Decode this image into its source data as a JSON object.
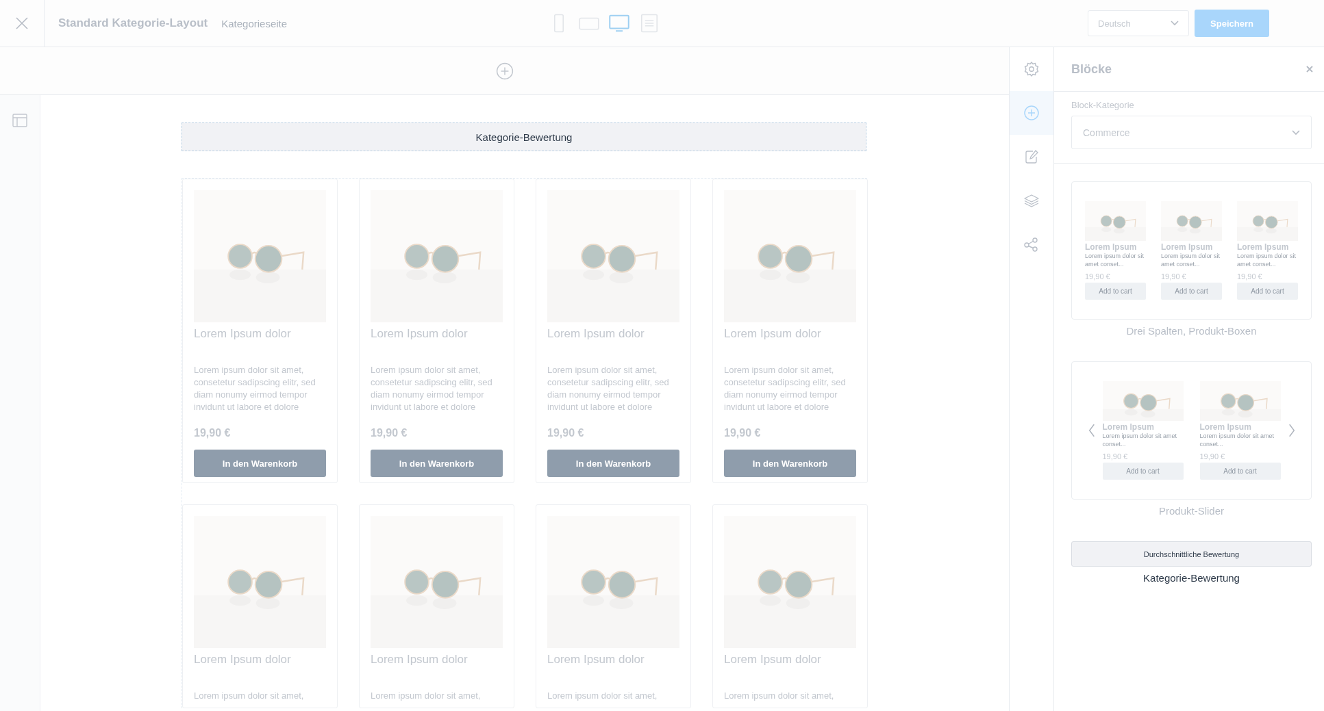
{
  "toolbar": {
    "title": "Standard Kategorie-Layout",
    "subtitle": "Kategorieseite",
    "devices": [
      {
        "kind": "mobile",
        "selected": false
      },
      {
        "kind": "tablet",
        "selected": false
      },
      {
        "kind": "desktop",
        "selected": true
      },
      {
        "kind": "list",
        "selected": false
      }
    ],
    "language": "Deutsch",
    "save": "Speichern"
  },
  "canvas": {
    "rating_block": "Kategorie-Bewertung",
    "products": [
      {
        "title": "Lorem Ipsum dolor",
        "description": "Lorem ipsum dolor sit amet, consetetur sadipscing elitr, sed diam nonumy eirmod tempor invidunt ut labore et dolore",
        "price": "19,90 €",
        "button": "In den Warenkorb"
      },
      {
        "title": "Lorem Ipsum dolor",
        "description": "Lorem ipsum dolor sit amet, consetetur sadipscing elitr, sed diam nonumy eirmod tempor invidunt ut labore et dolore",
        "price": "19,90 €",
        "button": "In den Warenkorb"
      },
      {
        "title": "Lorem Ipsum dolor",
        "description": "Lorem ipsum dolor sit amet, consetetur sadipscing elitr, sed diam nonumy eirmod tempor invidunt ut labore et dolore",
        "price": "19,90 €",
        "button": "In den Warenkorb"
      },
      {
        "title": "Lorem Ipsum dolor",
        "description": "Lorem ipsum dolor sit amet, consetetur sadipscing elitr, sed diam nonumy eirmod tempor invidunt ut labore et dolore",
        "price": "19,90 €",
        "button": "In den Warenkorb"
      },
      {
        "title": "Lorem Ipsum dolor",
        "description": "Lorem ipsum dolor sit amet,"
      },
      {
        "title": "Lorem Ipsum dolor",
        "description": "Lorem ipsum dolor sit amet,"
      },
      {
        "title": "Lorem Ipsum dolor",
        "description": "Lorem ipsum dolor sit amet,"
      },
      {
        "title": "Lorem Ipsum dolor",
        "description": "Lorem ipsum dolor sit amet,"
      }
    ]
  },
  "sidebar_tabs": [
    {
      "kind": "settings",
      "selected": false
    },
    {
      "kind": "add",
      "selected": true
    },
    {
      "kind": "edit",
      "selected": false
    },
    {
      "kind": "layers",
      "selected": false
    },
    {
      "kind": "share",
      "selected": false
    }
  ],
  "panel": {
    "title": "Blöcke",
    "category_label": "Block-Kategorie",
    "category": "Commerce",
    "blocks": [
      {
        "kind": "product-boxes",
        "caption": "Drei Spalten, Produkt-Boxen",
        "items": [
          {
            "title": "Lorem Ipsum",
            "description": "Lorem ipsum dolor sit amet conset...",
            "price": "19,90 €",
            "button": "Add to cart"
          },
          {
            "title": "Lorem Ipsum",
            "description": "Lorem ipsum dolor sit amet conset...",
            "price": "19,90 €",
            "button": "Add to cart"
          },
          {
            "title": "Lorem Ipsum",
            "description": "Lorem ipsum dolor sit amet conset...",
            "price": "19,90 €",
            "button": "Add to cart"
          }
        ]
      },
      {
        "kind": "slider",
        "caption": "Produkt-Slider",
        "items": [
          {
            "title": "Lorem Ipsum",
            "description": "Lorem ipsum dolor sit amet conset...",
            "price": "19,90 €",
            "button": "Add to cart"
          },
          {
            "title": "Lorem Ipsum",
            "description": "Lorem ipsum dolor sit amet conset...",
            "price": "19,90 €",
            "button": "Add to cart"
          }
        ]
      },
      {
        "kind": "rating",
        "caption": "Kategorie-Bewertung",
        "button": "Durchschnittliche Bewertung"
      }
    ]
  }
}
